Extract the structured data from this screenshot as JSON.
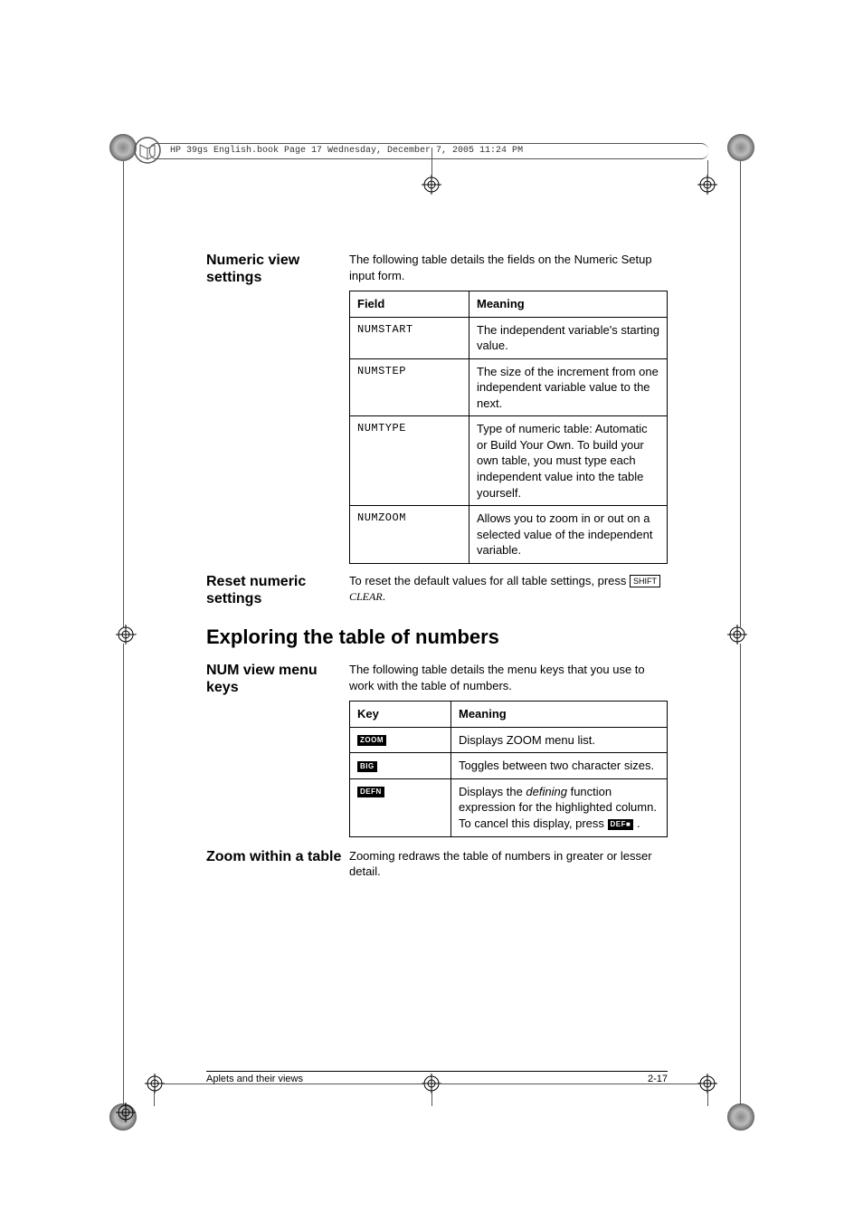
{
  "header_text": "HP 39gs English.book  Page 17  Wednesday, December 7, 2005  11:24 PM",
  "sections": {
    "numeric_view": {
      "heading": "Numeric view settings",
      "intro": "The following table details the fields on the Numeric Setup input form.",
      "table": {
        "head": [
          "Field",
          "Meaning"
        ],
        "rows": [
          {
            "field": "NUMSTART",
            "meaning": "The independent variable's starting value."
          },
          {
            "field": "NUMSTEP",
            "meaning": "The size of the increment from one independent variable value to the next."
          },
          {
            "field": "NUMTYPE",
            "meaning": "Type of numeric table: Automatic or Build Your Own. To build your own table, you must type each independent value into the table yourself."
          },
          {
            "field": "NUMZOOM",
            "meaning": "Allows you to zoom in or out on a selected value of the independent variable."
          }
        ]
      }
    },
    "reset": {
      "heading": "Reset numeric settings",
      "text_before": "To reset the default values for all table settings, press ",
      "key1": "SHIFT",
      "key2": "CLEAR",
      "text_after": "."
    },
    "explore_heading": "Exploring the table of numbers",
    "num_menu": {
      "heading": "NUM view menu keys",
      "intro": "The following table details the menu keys that you use to work with the table of numbers.",
      "table": {
        "head": [
          "Key",
          "Meaning"
        ],
        "rows": [
          {
            "key": "ZOOM",
            "meaning_plain": "Displays ZOOM menu list."
          },
          {
            "key": "BIG",
            "meaning_plain": "Toggles between two character sizes."
          },
          {
            "key": "DEFN",
            "meaning_before": "Displays the ",
            "meaning_italic": "defining",
            "meaning_mid": " function expression for the highlighted column. To cancel this display, press ",
            "cancel_key": "DEF■",
            "meaning_after": " ."
          }
        ]
      }
    },
    "zoom": {
      "heading": "Zoom within a table",
      "text": "Zooming redraws the table of numbers in greater or lesser detail."
    }
  },
  "footer": {
    "left": "Aplets and their views",
    "right": "2-17"
  }
}
